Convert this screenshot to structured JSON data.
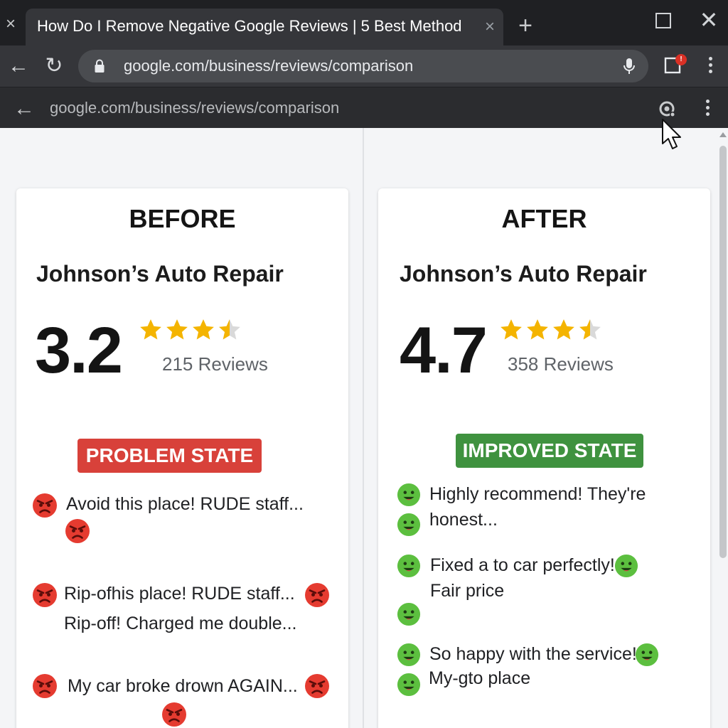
{
  "browser": {
    "tab_close_glyph": "×",
    "tab_title": "How Do I Remove Negative Google Reviews | 5 Best Method",
    "tab_close_tab_glyph": "×",
    "new_tab_glyph": "+",
    "window_close_glyph": "✕",
    "back_glyph": "←",
    "reload_glyph": "↻",
    "url": "google.com/business/reviews/comparison",
    "ext_badge": "!"
  },
  "secondary_bar": {
    "back_glyph": "←",
    "url": "google.com/business/reviews/comparison"
  },
  "before": {
    "heading": "BEFORE",
    "business": "Johnson’s Auto Repair",
    "rating": "3.2",
    "rating_value": 3.2,
    "reviews": "215 Reviews",
    "badge": "PROBLEM STATE",
    "lines": [
      "Avoid this place! RUDE staff...",
      "Rip-ofhis place! RUDE staff...",
      "Rip-off! Charged me double...",
      "My car broke drown AGAIN..."
    ]
  },
  "after": {
    "heading": "AFTER",
    "business": "Johnson’s Auto Repair",
    "rating": "4.7",
    "rating_value": 4.7,
    "reviews": "358 Reviews",
    "badge": "IMPROVED STATE",
    "lines": [
      "Highly recommend! They're",
      "honest...",
      "Fixed a to car perfectly!",
      "Fair price",
      "So happy with the service!",
      "My-gto place"
    ]
  },
  "colors": {
    "star": "#f4b400",
    "star_empty": "#d9d9d9",
    "angry_emoji": "#e53b30",
    "happy_emoji": "#5cbf3f",
    "problem_badge": "#d8413a",
    "improved_badge": "#3f923f"
  },
  "icons": [
    "lock-icon",
    "mic-icon",
    "extension-icon",
    "kebab-menu-icon",
    "lens-icon",
    "cursor-icon",
    "angry-face-icon",
    "smiley-face-icon",
    "star-icon"
  ]
}
